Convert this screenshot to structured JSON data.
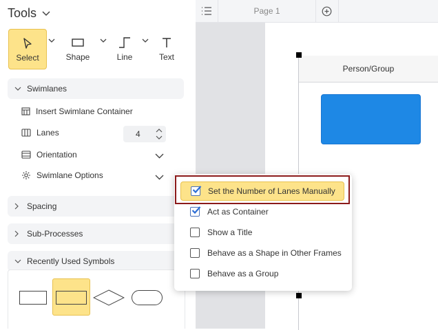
{
  "tools_panel": {
    "title": "Tools",
    "tools": [
      {
        "label": "Select",
        "icon": "cursor-icon"
      },
      {
        "label": "Shape",
        "icon": "rectangle-icon"
      },
      {
        "label": "Line",
        "icon": "line-icon"
      },
      {
        "label": "Text",
        "icon": "text-icon"
      }
    ],
    "sections": {
      "swimlanes": "Swimlanes",
      "spacing": "Spacing",
      "sub_processes": "Sub-Processes",
      "recently_used": "Recently Used Symbols"
    },
    "swimlane_items": {
      "insert_container": "Insert Swimlane Container",
      "lanes": "Lanes",
      "lanes_value": "4",
      "orientation": "Orientation",
      "options": "Swimlane Options"
    }
  },
  "canvas": {
    "page_tab": "Page 1",
    "swimlane_header": "Person/Group",
    "shape_color": "#1e88e5"
  },
  "options_menu": {
    "items": [
      {
        "label": "Set the Number of Lanes Manually",
        "checked": true
      },
      {
        "label": "Act as Container",
        "checked": true
      },
      {
        "label": "Show a Title",
        "checked": false
      },
      {
        "label": "Behave as a Shape in Other Frames",
        "checked": false
      },
      {
        "label": "Behave as a Group",
        "checked": false
      }
    ]
  },
  "colors": {
    "accent_yellow": "#fde38a",
    "highlight_border": "#8b1a1a",
    "checkbox_blue": "#2d6ed6"
  }
}
